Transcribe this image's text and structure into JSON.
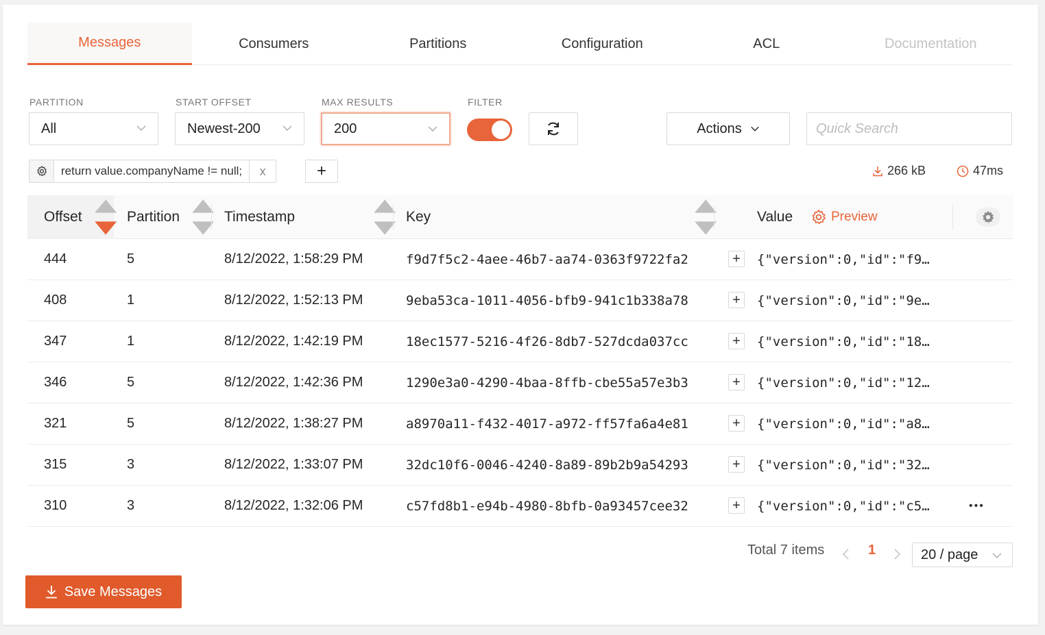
{
  "tabs": [
    {
      "label": "Messages",
      "state": "active"
    },
    {
      "label": "Consumers",
      "state": "normal"
    },
    {
      "label": "Partitions",
      "state": "normal"
    },
    {
      "label": "Configuration",
      "state": "normal"
    },
    {
      "label": "ACL",
      "state": "normal"
    },
    {
      "label": "Documentation",
      "state": "disabled"
    }
  ],
  "controls": {
    "partition_label": "PARTITION",
    "partition_value": "All",
    "start_offset_label": "START OFFSET",
    "start_offset_value": "Newest-200",
    "max_results_label": "MAX RESULTS",
    "max_results_value": "200",
    "filter_label": "FILTER",
    "filter_enabled": true,
    "actions_label": "Actions",
    "quick_search_placeholder": "Quick Search"
  },
  "filter": {
    "code": "return value.companyName != null;",
    "remove_glyph": "x",
    "add_glyph": "+"
  },
  "stats": {
    "size": "266 kB",
    "duration": "47ms"
  },
  "table": {
    "columns": {
      "offset": "Offset",
      "partition": "Partition",
      "timestamp": "Timestamp",
      "key": "Key",
      "value": "Value",
      "preview": "Preview"
    },
    "rows": [
      {
        "offset": "444",
        "partition": "5",
        "timestamp": "8/12/2022, 1:58:29 PM",
        "key": "f9d7f5c2-4aee-46b7-aa74-0363f9722fa2",
        "value": "{\"version\":0,\"id\":\"f9…"
      },
      {
        "offset": "408",
        "partition": "1",
        "timestamp": "8/12/2022, 1:52:13 PM",
        "key": "9eba53ca-1011-4056-bfb9-941c1b338a78",
        "value": "{\"version\":0,\"id\":\"9e…"
      },
      {
        "offset": "347",
        "partition": "1",
        "timestamp": "8/12/2022, 1:42:19 PM",
        "key": "18ec1577-5216-4f26-8db7-527dcda037cc",
        "value": "{\"version\":0,\"id\":\"18…"
      },
      {
        "offset": "346",
        "partition": "5",
        "timestamp": "8/12/2022, 1:42:36 PM",
        "key": "1290e3a0-4290-4baa-8ffb-cbe55a57e3b3",
        "value": "{\"version\":0,\"id\":\"12…"
      },
      {
        "offset": "321",
        "partition": "5",
        "timestamp": "8/12/2022, 1:38:27 PM",
        "key": "a8970a11-f432-4017-a972-ff57fa6a4e81",
        "value": "{\"version\":0,\"id\":\"a8…"
      },
      {
        "offset": "315",
        "partition": "3",
        "timestamp": "8/12/2022, 1:33:07 PM",
        "key": "32dc10f6-0046-4240-8a89-89b2b9a54293",
        "value": "{\"version\":0,\"id\":\"32…"
      },
      {
        "offset": "310",
        "partition": "3",
        "timestamp": "8/12/2022, 1:32:06 PM",
        "key": "c57fd8b1-e94b-4980-8bfb-0a93457cee32",
        "value": "{\"version\":0,\"id\":\"c5…"
      }
    ],
    "row_more_glyph": "•••"
  },
  "pagination": {
    "total": "Total 7 items",
    "current_page": "1",
    "page_size": "20 / page"
  },
  "save_button": "Save Messages",
  "colors": {
    "accent": "#e8643a",
    "save_bg": "#e05a2b"
  }
}
